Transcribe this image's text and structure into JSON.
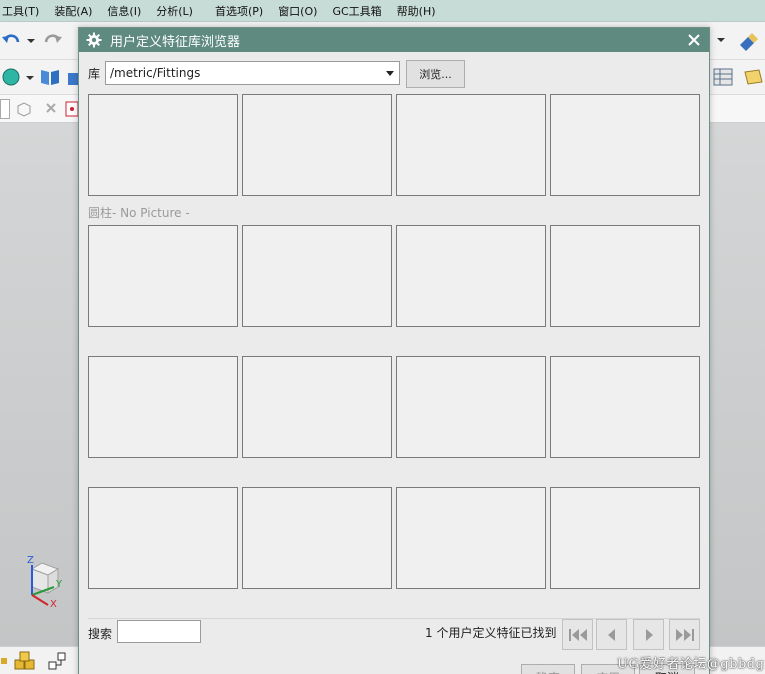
{
  "menubar": {
    "items": [
      "工具(T)",
      "装配(A)",
      "信息(I)",
      "分析(L)",
      "首选项(P)",
      "窗口(O)",
      "GC工具箱",
      "帮助(H)"
    ]
  },
  "dialog": {
    "title": "用户定义特征库浏览器",
    "library_label": "库",
    "library_path": "/metric/Fittings",
    "browse_label": "浏览...",
    "grid": [
      {
        "caption": ""
      },
      {
        "caption": ""
      },
      {
        "caption": ""
      },
      {
        "caption": ""
      },
      {
        "caption": "圆柱- No Picture -"
      },
      {
        "caption": ""
      },
      {
        "caption": ""
      },
      {
        "caption": ""
      },
      {
        "caption": ""
      },
      {
        "caption": ""
      },
      {
        "caption": ""
      },
      {
        "caption": ""
      },
      {
        "caption": ""
      },
      {
        "caption": ""
      },
      {
        "caption": ""
      },
      {
        "caption": ""
      }
    ],
    "search_label": "搜索",
    "search_value": "",
    "status": "1 个用户定义特征已找到",
    "nav_icons": [
      "first-page-icon",
      "previous-page-icon",
      "next-page-icon",
      "last-page-icon"
    ],
    "footer": {
      "ok": "确定",
      "apply": "应用",
      "cancel": "取消"
    }
  },
  "triad": {
    "x_label": "X",
    "y_label": "Y",
    "z_label": "Z"
  },
  "watermark": "UG爱好者论坛@gbbdg",
  "colors": {
    "title_bar": "#5f8a7f",
    "menubar": "#c7dcd6",
    "dialog_bg": "#ebebeb",
    "thumb_bg": "#f0f0f0"
  }
}
